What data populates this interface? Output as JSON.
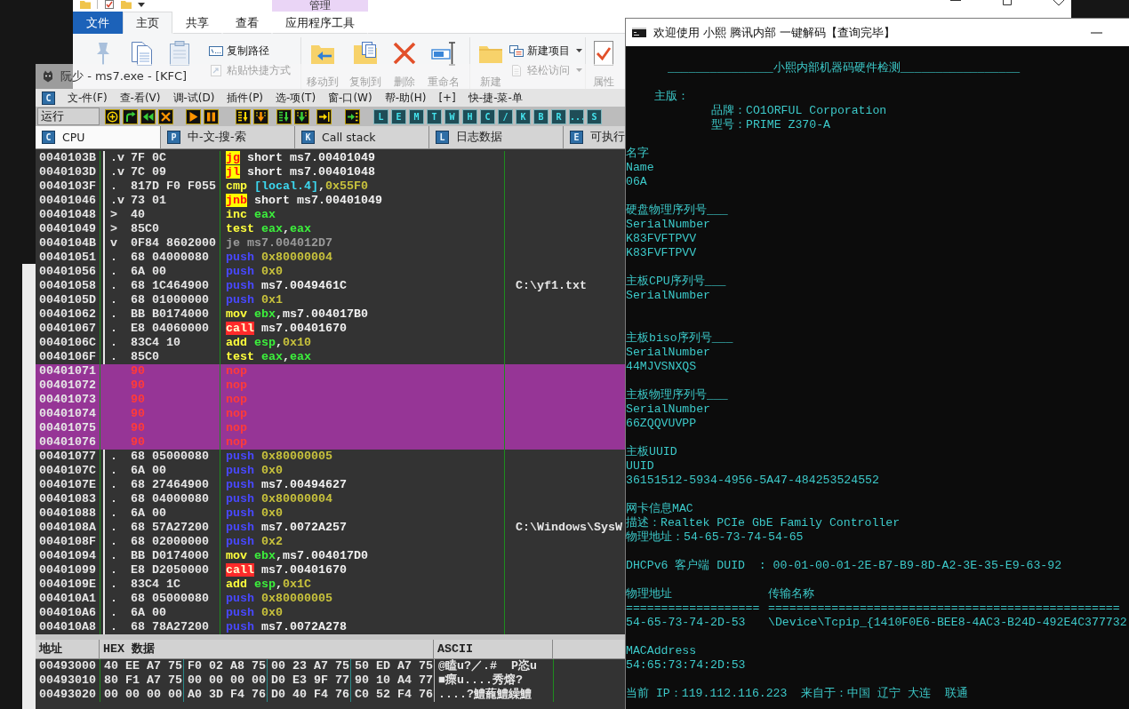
{
  "explorer": {
    "context_header": "管理",
    "tabs": [
      {
        "label": "文件",
        "kind": "file",
        "selected": false
      },
      {
        "label": "主页",
        "kind": "tab",
        "selected": true
      },
      {
        "label": "共享",
        "kind": "tab",
        "selected": false
      },
      {
        "label": "查看",
        "kind": "tab",
        "selected": false
      },
      {
        "label": "应用程序工具",
        "kind": "tab",
        "selected": false
      }
    ],
    "ribbon": {
      "clipboard_small": [
        {
          "label": "复制路径",
          "kind": "copy-path",
          "dropdown": false
        },
        {
          "label": "粘贴快捷方式",
          "kind": "paste-shortcut",
          "dropdown": false
        }
      ],
      "organize": [
        {
          "label": "移动到",
          "kind": "move"
        },
        {
          "label": "复制到",
          "kind": "copy"
        },
        {
          "label": "删除",
          "kind": "delete"
        },
        {
          "label": "重命名",
          "kind": "rename"
        }
      ],
      "new": [
        {
          "label": "新建",
          "kind": "new-folder"
        }
      ],
      "new_small": [
        {
          "label": "新建项目",
          "kind": "new-item",
          "dropdown": true
        },
        {
          "label": "轻松访问",
          "kind": "easy-access",
          "dropdown": true
        }
      ],
      "open": [
        {
          "label": "属性",
          "kind": "properties"
        }
      ]
    }
  },
  "debugger": {
    "title": "阮少 - ms7.exe - [KFC]",
    "menu_letter": "C",
    "menu": [
      "文-件(F)",
      "查-看(V)",
      "调-试(D)",
      "插件(P)",
      "选-项(T)",
      "窗-口(W)",
      "帮-助(H)",
      "[+]",
      "快-捷-菜-单"
    ],
    "status": "运行",
    "letter_buttons": [
      "L",
      "E",
      "M",
      "T",
      "W",
      "H",
      "C",
      "/",
      "K",
      "B",
      "R",
      "...",
      "S"
    ],
    "tabs": [
      {
        "icon_letter": "C",
        "label": "CPU",
        "selected": true
      },
      {
        "icon_letter": "P",
        "label": "中-文-搜-索",
        "selected": false
      },
      {
        "icon_letter": "K",
        "label": "Call stack",
        "selected": false
      },
      {
        "icon_letter": "L",
        "label": "日志数据",
        "selected": false
      },
      {
        "icon_letter": "E",
        "label": "可执行",
        "selected": false
      }
    ],
    "disassembly": [
      {
        "address": "0040103B",
        "marker": ".v",
        "hex": "7F 0C",
        "mnemonic": {
          "text": "jg",
          "kind": "jump"
        },
        "operands": [
          {
            "text": "short ms7.00401049",
            "kind": "addr"
          }
        ],
        "highlighted": false
      },
      {
        "address": "0040103D",
        "marker": ".v",
        "hex": "7C 09",
        "mnemonic": {
          "text": "jl",
          "kind": "jump"
        },
        "operands": [
          {
            "text": "short ms7.00401048",
            "kind": "addr"
          }
        ],
        "highlighted": false
      },
      {
        "address": "0040103F",
        "marker": ".",
        "hex": "817D F0 F055",
        "mnemonic": {
          "text": "cmp",
          "kind": "op"
        },
        "operands": [
          {
            "text": "[local.4]",
            "kind": "mem"
          },
          {
            "text": ",",
            "kind": "plain"
          },
          {
            "text": "0x55F0",
            "kind": "num"
          }
        ],
        "highlighted": false
      },
      {
        "address": "00401046",
        "marker": ".v",
        "hex": "73 01",
        "mnemonic": {
          "text": "jnb",
          "kind": "jump"
        },
        "operands": [
          {
            "text": "short ms7.00401049",
            "kind": "addr"
          }
        ],
        "highlighted": false
      },
      {
        "address": "00401048",
        "marker": ">",
        "hex": "40",
        "mnemonic": {
          "text": "inc",
          "kind": "op"
        },
        "operands": [
          {
            "text": "eax",
            "kind": "reg"
          }
        ],
        "highlighted": false
      },
      {
        "address": "00401049",
        "marker": ">",
        "hex": "85C0",
        "mnemonic": {
          "text": "test",
          "kind": "op"
        },
        "operands": [
          {
            "text": "eax",
            "kind": "reg"
          },
          {
            "text": ",",
            "kind": "plain"
          },
          {
            "text": "eax",
            "kind": "reg"
          }
        ],
        "highlighted": false
      },
      {
        "address": "0040104B",
        "marker": "v",
        "hex": "0F84 8602000",
        "mnemonic": {
          "text": "je",
          "kind": "dim"
        },
        "operands": [
          {
            "text": "ms7.004012D7",
            "kind": "dim"
          }
        ],
        "highlighted": false
      },
      {
        "address": "00401051",
        "marker": ".",
        "hex": "68 04000080",
        "mnemonic": {
          "text": "push",
          "kind": "push"
        },
        "operands": [
          {
            "text": "0x80000004",
            "kind": "num"
          }
        ],
        "highlighted": false
      },
      {
        "address": "00401056",
        "marker": ".",
        "hex": "6A 00",
        "mnemonic": {
          "text": "push",
          "kind": "push"
        },
        "operands": [
          {
            "text": "0x0",
            "kind": "num"
          }
        ],
        "highlighted": false
      },
      {
        "address": "00401058",
        "marker": ".",
        "hex": "68 1C464900",
        "mnemonic": {
          "text": "push",
          "kind": "push"
        },
        "operands": [
          {
            "text": "ms7.0049461C",
            "kind": "addr"
          }
        ],
        "comment": "C:\\yf1.txt",
        "highlighted": false
      },
      {
        "address": "0040105D",
        "marker": ".",
        "hex": "68 01000000",
        "mnemonic": {
          "text": "push",
          "kind": "push"
        },
        "operands": [
          {
            "text": "0x1",
            "kind": "num"
          }
        ],
        "highlighted": false
      },
      {
        "address": "00401062",
        "marker": ".",
        "hex": "BB B0174000",
        "mnemonic": {
          "text": "mov",
          "kind": "op"
        },
        "operands": [
          {
            "text": "ebx",
            "kind": "reg"
          },
          {
            "text": ",",
            "kind": "plain"
          },
          {
            "text": "ms7.004017B0",
            "kind": "addr"
          }
        ],
        "highlighted": false
      },
      {
        "address": "00401067",
        "marker": ".",
        "hex": "E8 04060000",
        "mnemonic": {
          "text": "call",
          "kind": "call"
        },
        "operands": [
          {
            "text": "ms7.00401670",
            "kind": "addr"
          }
        ],
        "highlighted": false
      },
      {
        "address": "0040106C",
        "marker": ".",
        "hex": "83C4 10",
        "mnemonic": {
          "text": "add",
          "kind": "op"
        },
        "operands": [
          {
            "text": "esp",
            "kind": "reg"
          },
          {
            "text": ",",
            "kind": "plain"
          },
          {
            "text": "0x10",
            "kind": "num"
          }
        ],
        "highlighted": false
      },
      {
        "address": "0040106F",
        "marker": ".",
        "hex": "85C0",
        "mnemonic": {
          "text": "test",
          "kind": "op"
        },
        "operands": [
          {
            "text": "eax",
            "kind": "reg"
          },
          {
            "text": ",",
            "kind": "plain"
          },
          {
            "text": "eax",
            "kind": "reg"
          }
        ],
        "highlighted": false
      },
      {
        "address": "00401071",
        "hex": "90",
        "mnemonic": {
          "text": "nop",
          "kind": "nop"
        },
        "highlighted": true
      },
      {
        "address": "00401072",
        "hex": "90",
        "mnemonic": {
          "text": "nop",
          "kind": "nop"
        },
        "highlighted": true
      },
      {
        "address": "00401073",
        "hex": "90",
        "mnemonic": {
          "text": "nop",
          "kind": "nop"
        },
        "highlighted": true
      },
      {
        "address": "00401074",
        "hex": "90",
        "mnemonic": {
          "text": "nop",
          "kind": "nop"
        },
        "highlighted": true
      },
      {
        "address": "00401075",
        "hex": "90",
        "mnemonic": {
          "text": "nop",
          "kind": "nop"
        },
        "highlighted": true
      },
      {
        "address": "00401076",
        "hex": "90",
        "mnemonic": {
          "text": "nop",
          "kind": "nop"
        },
        "highlighted": true
      },
      {
        "address": "00401077",
        "marker": ".",
        "hex": "68 05000080",
        "mnemonic": {
          "text": "push",
          "kind": "push"
        },
        "operands": [
          {
            "text": "0x80000005",
            "kind": "num"
          }
        ],
        "highlighted": false
      },
      {
        "address": "0040107C",
        "marker": ".",
        "hex": "6A 00",
        "mnemonic": {
          "text": "push",
          "kind": "push"
        },
        "operands": [
          {
            "text": "0x0",
            "kind": "num"
          }
        ],
        "highlighted": false
      },
      {
        "address": "0040107E",
        "marker": ".",
        "hex": "68 27464900",
        "mnemonic": {
          "text": "push",
          "kind": "push"
        },
        "operands": [
          {
            "text": "ms7.00494627",
            "kind": "addr"
          }
        ],
        "highlighted": false
      },
      {
        "address": "00401083",
        "marker": ".",
        "hex": "68 04000080",
        "mnemonic": {
          "text": "push",
          "kind": "push"
        },
        "operands": [
          {
            "text": "0x80000004",
            "kind": "num"
          }
        ],
        "highlighted": false
      },
      {
        "address": "00401088",
        "marker": ".",
        "hex": "6A 00",
        "mnemonic": {
          "text": "push",
          "kind": "push"
        },
        "operands": [
          {
            "text": "0x0",
            "kind": "num"
          }
        ],
        "highlighted": false
      },
      {
        "address": "0040108A",
        "marker": ".",
        "hex": "68 57A27200",
        "mnemonic": {
          "text": "push",
          "kind": "push"
        },
        "operands": [
          {
            "text": "ms7.0072A257",
            "kind": "addr"
          }
        ],
        "comment": "C:\\Windows\\SysW",
        "highlighted": false
      },
      {
        "address": "0040108F",
        "marker": ".",
        "hex": "68 02000000",
        "mnemonic": {
          "text": "push",
          "kind": "push"
        },
        "operands": [
          {
            "text": "0x2",
            "kind": "num"
          }
        ],
        "highlighted": false
      },
      {
        "address": "00401094",
        "marker": ".",
        "hex": "BB D0174000",
        "mnemonic": {
          "text": "mov",
          "kind": "op"
        },
        "operands": [
          {
            "text": "ebx",
            "kind": "reg"
          },
          {
            "text": ",",
            "kind": "plain"
          },
          {
            "text": "ms7.004017D0",
            "kind": "addr"
          }
        ],
        "highlighted": false
      },
      {
        "address": "00401099",
        "marker": ".",
        "hex": "E8 D2050000",
        "mnemonic": {
          "text": "call",
          "kind": "call"
        },
        "operands": [
          {
            "text": "ms7.00401670",
            "kind": "addr"
          }
        ],
        "highlighted": false
      },
      {
        "address": "0040109E",
        "marker": ".",
        "hex": "83C4 1C",
        "mnemonic": {
          "text": "add",
          "kind": "op"
        },
        "operands": [
          {
            "text": "esp",
            "kind": "reg"
          },
          {
            "text": ",",
            "kind": "plain"
          },
          {
            "text": "0x1C",
            "kind": "num"
          }
        ],
        "highlighted": false
      },
      {
        "address": "004010A1",
        "marker": ".",
        "hex": "68 05000080",
        "mnemonic": {
          "text": "push",
          "kind": "push"
        },
        "operands": [
          {
            "text": "0x80000005",
            "kind": "num"
          }
        ],
        "highlighted": false
      },
      {
        "address": "004010A6",
        "marker": ".",
        "hex": "6A 00",
        "mnemonic": {
          "text": "push",
          "kind": "push"
        },
        "operands": [
          {
            "text": "0x0",
            "kind": "num"
          }
        ],
        "highlighted": false
      },
      {
        "address": "004010A8",
        "marker": ".",
        "hex": "68 78A27200",
        "mnemonic": {
          "text": "push",
          "kind": "push"
        },
        "operands": [
          {
            "text": "ms7.0072A278",
            "kind": "addr"
          }
        ],
        "highlighted": false
      }
    ],
    "dump": {
      "columns": [
        "地址",
        "HEX 数据",
        "ASCII"
      ],
      "rows": [
        {
          "address": "00493000",
          "bytes": [
            "40 EE A7 75",
            "F0 02 A8 75",
            "00 23 A7 75",
            "50 ED A7 75"
          ],
          "ascii": "@瞌u?／.#  P恣u"
        },
        {
          "address": "00493010",
          "bytes": [
            "80 F1 A7 75",
            "00 00 00 00",
            "D0 E3 9F 77",
            "90 10 A4 77"
          ],
          "ascii": "■瘝u....秀熔?"
        },
        {
          "address": "00493020",
          "bytes": [
            "00 00 00 00",
            "A0 3D F4 76",
            "D0 40 F4 76",
            "C0 52 F4 76"
          ],
          "ascii": "....?鱧蘢鱧繰鱧"
        }
      ]
    }
  },
  "console": {
    "title": "欢迎使用 小熙 腾讯内部 一键解码【查询完毕】",
    "lines": [
      {
        "text": "_______________小熙内部机器码硬件检测_________________",
        "kind": "banner"
      },
      {
        "kind": "blank"
      },
      {
        "text": "主版：",
        "kind": "group"
      },
      {
        "text": "品牌：CO1ORFUL Corporation",
        "kind": "field"
      },
      {
        "text": "型号：PRIME Z370-A",
        "kind": "field"
      },
      {
        "kind": "blank"
      },
      {
        "text": "名字",
        "kind": "plain"
      },
      {
        "text": "Name",
        "kind": "plain"
      },
      {
        "text": "06A",
        "kind": "plain"
      },
      {
        "kind": "blank"
      },
      {
        "text": "硬盘物理序列号___",
        "kind": "plain"
      },
      {
        "text": "SerialNumber",
        "kind": "plain"
      },
      {
        "text": "K83FVFTPVV",
        "kind": "plain"
      },
      {
        "text": "K83FVFTPVV",
        "kind": "plain"
      },
      {
        "kind": "blank"
      },
      {
        "text": "主板CPU序列号___",
        "kind": "plain"
      },
      {
        "text": "SerialNumber",
        "kind": "plain"
      },
      {
        "kind": "blank"
      },
      {
        "kind": "blank"
      },
      {
        "text": "主板biso序列号___",
        "kind": "plain"
      },
      {
        "text": "SerialNumber",
        "kind": "plain"
      },
      {
        "text": "44MJVSNXQS",
        "kind": "plain"
      },
      {
        "kind": "blank"
      },
      {
        "text": "主板物理序列号___",
        "kind": "plain"
      },
      {
        "text": "SerialNumber",
        "kind": "plain"
      },
      {
        "text": "66ZQQVUVPP",
        "kind": "plain"
      },
      {
        "kind": "blank"
      },
      {
        "text": "主板UUID",
        "kind": "plain"
      },
      {
        "text": "UUID",
        "kind": "plain"
      },
      {
        "text": "36151512-5934-4956-5A47-484253524552",
        "kind": "plain"
      },
      {
        "kind": "blank"
      },
      {
        "text": "网卡信息MAC",
        "kind": "plain"
      },
      {
        "text": "描述：Realtek PCIe GbE Family Controller",
        "kind": "plain"
      },
      {
        "text": "物理地址：54-65-73-74-54-65",
        "kind": "plain"
      },
      {
        "kind": "blank"
      },
      {
        "text": "DHCPv6 客户端 DUID  : 00-01-00-01-2E-B7-B9-8D-A2-3E-35-E9-63-92",
        "kind": "plain"
      },
      {
        "kind": "blank"
      },
      {
        "kind": "table",
        "columns": [
          "物理地址",
          "传输名称"
        ]
      },
      {
        "kind": "table",
        "columns": [
          "===================",
          "=================================================="
        ]
      },
      {
        "kind": "table",
        "columns": [
          "54-65-73-74-2D-53",
          "\\Device\\Tcpip_{1410F0E6-BEE8-4AC3-B24D-492E4C377732"
        ]
      },
      {
        "kind": "blank"
      },
      {
        "text": "MACAddress",
        "kind": "plain"
      },
      {
        "text": "54:65:73:74:2D:53",
        "kind": "plain"
      },
      {
        "kind": "blank"
      },
      {
        "text": "当前 IP：119.112.116.223  来自于：中国 辽宁 大连  联通",
        "kind": "plain"
      }
    ]
  }
}
